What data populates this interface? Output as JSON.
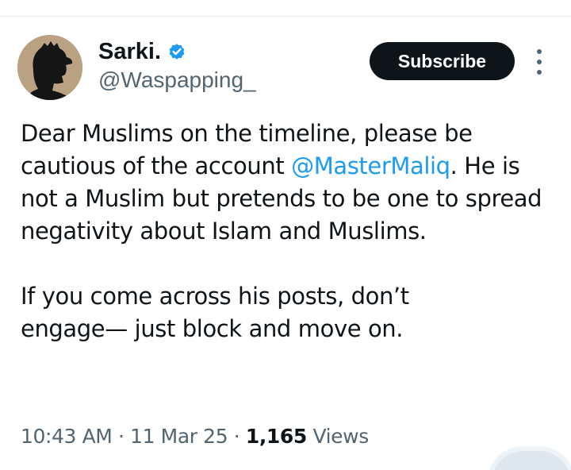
{
  "tweet": {
    "author": {
      "display_name": "Sarki.",
      "handle": "@Waspapping_",
      "verified_icon": "verified-badge-icon",
      "avatar_icon": "silhouette-profile-avatar"
    },
    "subscribe_label": "Subscribe",
    "more_icon": "more-vertical-icon",
    "body": {
      "p1_before": "Dear Muslims on the timeline, please be cautious of the account ",
      "mention": "@MasterMaliq",
      "p1_after": ". He is not a Muslim but pretends to be one to spread negativity about Islam and Muslims.",
      "p2_line1": "If you come across his posts, don’t",
      "p2_line2": "engage— just block and move on."
    },
    "meta": {
      "time": "10:43 AM",
      "date": "11 Mar 25",
      "separator": "·",
      "views_count": "1,165",
      "views_label": "Views"
    }
  },
  "colors": {
    "text": "#0f1419",
    "secondary": "#536471",
    "link": "#1d9bf0",
    "verified": "#1d9bf0",
    "button_bg": "#0f1419"
  }
}
